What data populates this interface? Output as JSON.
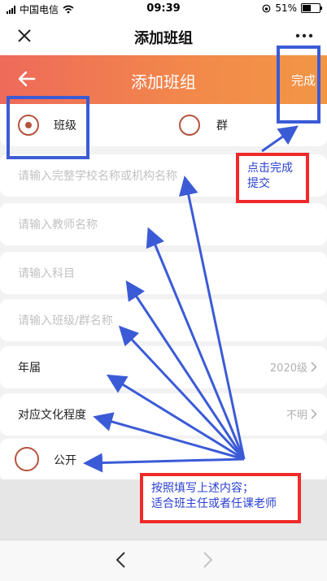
{
  "status_bar": {
    "carrier": "中国电信",
    "time": "09:39",
    "battery": "51%",
    "battery_level": 0.51
  },
  "nav": {
    "title": "添加班组"
  },
  "header": {
    "title": "添加班组",
    "done_label": "完成"
  },
  "form": {
    "type_options": [
      {
        "label": "班级",
        "selected": true
      },
      {
        "label": "群",
        "selected": false
      }
    ],
    "school_placeholder": "请输入完整学校名称或机构名称",
    "teacher_placeholder": "请输入教师名称",
    "subject_placeholder": "请输入科目",
    "class_placeholder": "请输入班级/群名称",
    "year_label": "年届",
    "year_value": "2020级",
    "level_label": "对应文化程度",
    "level_value": "不明",
    "public_label": "公开"
  },
  "annotations": {
    "submit_note": "点击完成提交",
    "fill_note_line1": "按照填写上述内容；",
    "fill_note_line2": "适合班主任或者任课老师"
  },
  "colors": {
    "header_start": "#ee6a5a",
    "header_end": "#f29646",
    "radio": "#b5533e",
    "annotation_blue": "#3b5bd6",
    "annotation_red": "#f02a2a"
  }
}
